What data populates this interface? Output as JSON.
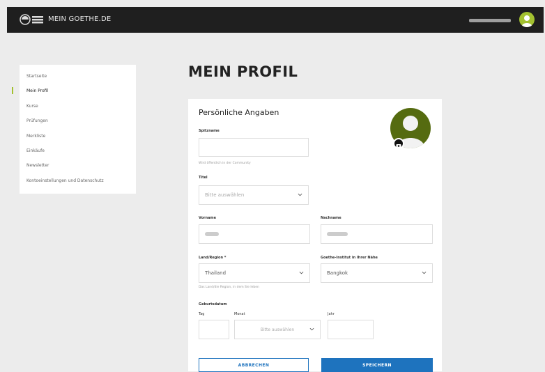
{
  "header": {
    "brand": "MEIN GOETHE.DE"
  },
  "sidebar": {
    "items": [
      {
        "label": "Startseite"
      },
      {
        "label": "Mein Profil"
      },
      {
        "label": "Kurse"
      },
      {
        "label": "Prüfungen"
      },
      {
        "label": "Merkliste"
      },
      {
        "label": "Einkäufe"
      },
      {
        "label": "Newsletter"
      },
      {
        "label": "Kontoeinstellungen und Datenschutz"
      }
    ]
  },
  "main": {
    "title": "MEIN PROFIL",
    "section_title": "Persönliche Angaben",
    "spitzname": {
      "label": "Spitzname",
      "value": "",
      "hint": "Wird öffentlich in der Community"
    },
    "titel": {
      "label": "Titel",
      "value": "Bitte auswählen"
    },
    "vorname": {
      "label": "Vorname"
    },
    "nachname": {
      "label": "Nachname"
    },
    "land": {
      "label": "Land/Region *",
      "value": "Thailand",
      "hint": "Das Land/die Region, in dem Sie leben"
    },
    "stadt": {
      "label": "Goethe-Institut in Ihrer Nähe",
      "value": "Bangkok"
    },
    "geburtsdatum": {
      "label": "Geburtsdatum",
      "tag_label": "Tag",
      "monat_label": "Monat",
      "jahr_label": "Jahr",
      "monat_value": "Bitte auswählen"
    },
    "buttons": {
      "cancel": "ABBRECHEN",
      "save": "SPEICHERN"
    }
  },
  "colors": {
    "accent": "#a3c130",
    "primary": "#1e73be",
    "topbar": "#1f1f1f"
  }
}
